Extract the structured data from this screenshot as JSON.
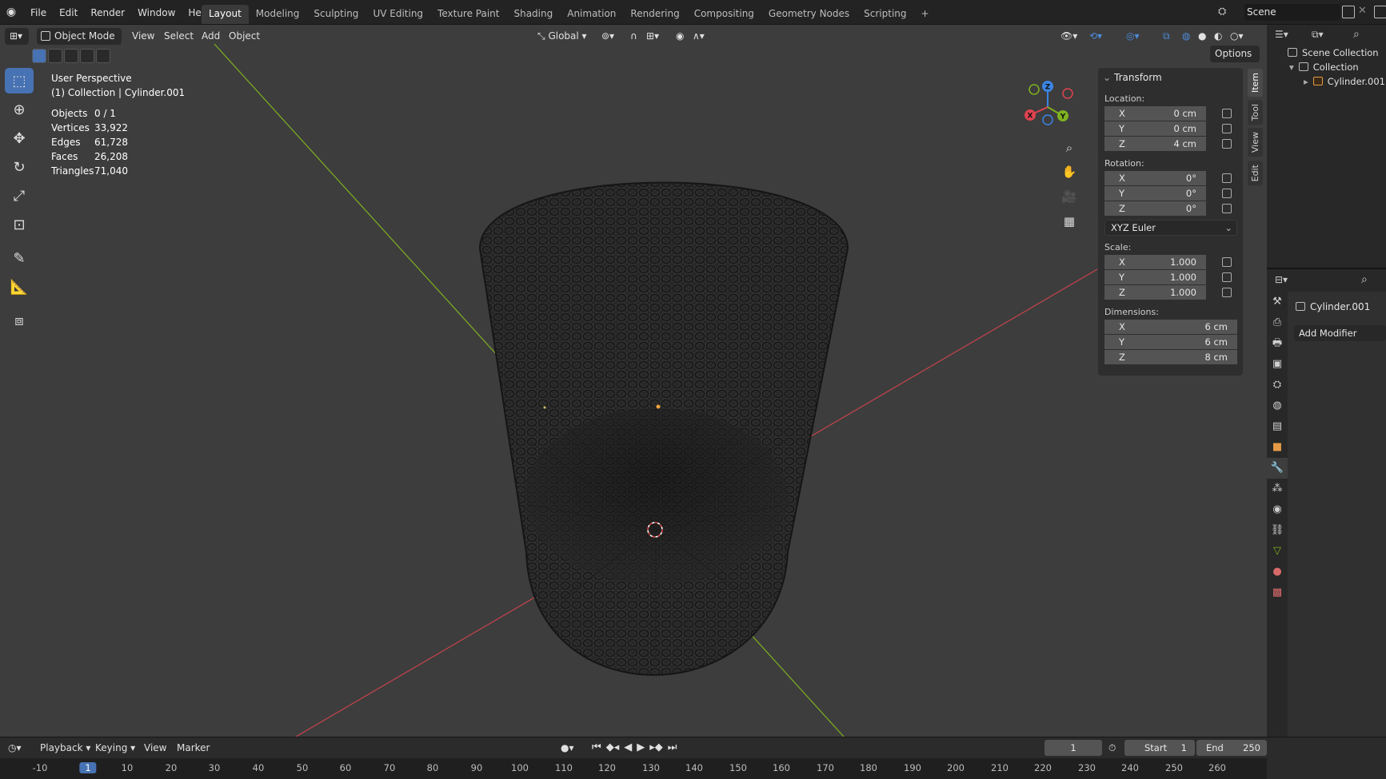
{
  "topbar": {
    "menus": [
      "File",
      "Edit",
      "Render",
      "Window",
      "Help"
    ],
    "workspaces": [
      "Layout",
      "Modeling",
      "Sculpting",
      "UV Editing",
      "Texture Paint",
      "Shading",
      "Animation",
      "Rendering",
      "Compositing",
      "Geometry Nodes",
      "Scripting",
      "+"
    ],
    "active_workspace": "Layout",
    "scene_name": "Scene"
  },
  "viewport_header": {
    "mode": "Object Mode",
    "menus": [
      "View",
      "Select",
      "Add",
      "Object"
    ],
    "orientation": "Global",
    "options_label": "Options"
  },
  "overlay": {
    "view_name": "User Perspective",
    "collection_info": "(1) Collection | Cylinder.001",
    "stats": [
      {
        "label": "Objects",
        "value": "0 / 1"
      },
      {
        "label": "Vertices",
        "value": "33,922"
      },
      {
        "label": "Edges",
        "value": "61,728"
      },
      {
        "label": "Faces",
        "value": "26,208"
      },
      {
        "label": "Triangles",
        "value": "71,040"
      }
    ]
  },
  "gizmo": {
    "x": "X",
    "y": "Y",
    "z": "Z"
  },
  "npanel": {
    "tabs": [
      "Item",
      "Tool",
      "View",
      "Edit"
    ],
    "active_tab": "Item",
    "section": "Transform",
    "location_label": "Location:",
    "location": [
      {
        "axis": "X",
        "value": "0 cm"
      },
      {
        "axis": "Y",
        "value": "0 cm"
      },
      {
        "axis": "Z",
        "value": "4 cm"
      }
    ],
    "rotation_label": "Rotation:",
    "rotation": [
      {
        "axis": "X",
        "value": "0°"
      },
      {
        "axis": "Y",
        "value": "0°"
      },
      {
        "axis": "Z",
        "value": "0°"
      }
    ],
    "rotation_mode": "XYZ Euler",
    "scale_label": "Scale:",
    "scale": [
      {
        "axis": "X",
        "value": "1.000"
      },
      {
        "axis": "Y",
        "value": "1.000"
      },
      {
        "axis": "Z",
        "value": "1.000"
      }
    ],
    "dimensions_label": "Dimensions:",
    "dimensions": [
      {
        "axis": "X",
        "value": "6 cm"
      },
      {
        "axis": "Y",
        "value": "6 cm"
      },
      {
        "axis": "Z",
        "value": "8 cm"
      }
    ]
  },
  "outliner": {
    "scene_collection": "Scene Collection",
    "collection": "Collection",
    "object": "Cylinder.001"
  },
  "properties": {
    "object_name": "Cylinder.001",
    "add_modifier": "Add Modifier"
  },
  "timeline": {
    "menus": [
      "Playback",
      "Keying",
      "View",
      "Marker"
    ],
    "current_frame": "1",
    "start_label": "Start",
    "start": "1",
    "end_label": "End",
    "end": "250",
    "ruler_ticks": [
      "-10",
      "1",
      "10",
      "20",
      "30",
      "40",
      "50",
      "60",
      "70",
      "80",
      "90",
      "100",
      "110",
      "120",
      "130",
      "140",
      "150",
      "160",
      "170",
      "180",
      "190",
      "200",
      "210",
      "220",
      "230",
      "240",
      "250",
      "260"
    ],
    "ruler_current": "1"
  },
  "colors": {
    "accent": "#4772b3",
    "axis_x": "#e0434f",
    "axis_y": "#7fb221",
    "axis_z": "#3b85e5",
    "viewport_bg": "#3d3d3d"
  }
}
